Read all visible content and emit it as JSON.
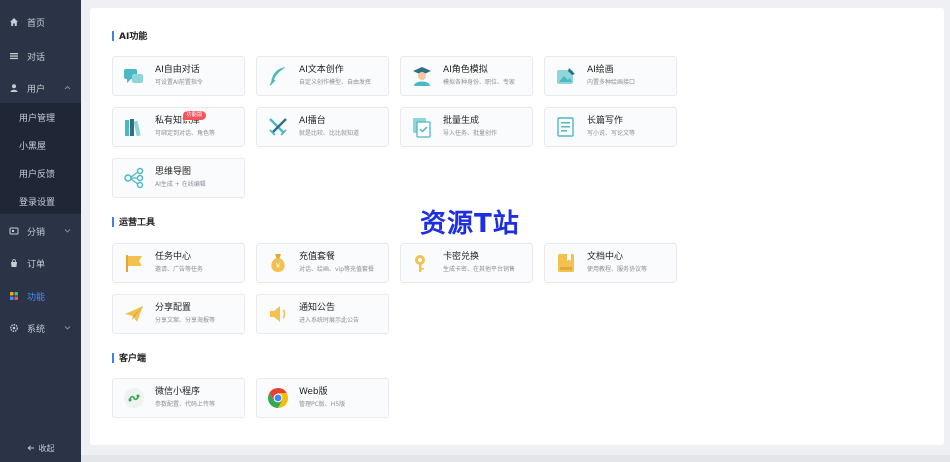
{
  "sidebar": {
    "items": [
      {
        "label": "首页",
        "icon": "home-icon"
      },
      {
        "label": "对话",
        "icon": "list-icon"
      },
      {
        "label": "用户",
        "icon": "user-icon"
      },
      {
        "label": "分销",
        "icon": "distribution-icon"
      },
      {
        "label": "订单",
        "icon": "bag-icon"
      },
      {
        "label": "功能",
        "icon": "grid-icon"
      },
      {
        "label": "系统",
        "icon": "gear-icon"
      }
    ],
    "user_submenu": [
      "用户管理",
      "小黑屋",
      "用户反馈",
      "登录设置"
    ],
    "collapse_label": "收起",
    "active_color": "#4a8df8"
  },
  "sections": [
    {
      "title": "AI功能",
      "cards": [
        {
          "name": "AI自由对话",
          "desc": "可设置AI前置指令",
          "icon": "chat-icon"
        },
        {
          "name": "AI文本创作",
          "desc": "自定义创作模型、自由发挥",
          "icon": "feather-icon"
        },
        {
          "name": "AI角色模拟",
          "desc": "模拟各种身份、职位、专家",
          "icon": "role-icon"
        },
        {
          "name": "AI绘画",
          "desc": "内置多种绘画接口",
          "icon": "paint-icon"
        },
        {
          "name": "私有知识库",
          "desc": "可绑定到对话、角色等",
          "icon": "books-icon",
          "badge": "功能版"
        },
        {
          "name": "AI擂台",
          "desc": "就是比较、比比就知道",
          "icon": "swords-icon"
        },
        {
          "name": "批量生成",
          "desc": "导入任务、批量创作",
          "icon": "batch-icon"
        },
        {
          "name": "长篇写作",
          "desc": "写小说、写论文等",
          "icon": "longtext-icon"
        },
        {
          "name": "思维导图",
          "desc": "AI生成 + 在线编辑",
          "icon": "mindmap-icon"
        }
      ]
    },
    {
      "title": "运营工具",
      "cards": [
        {
          "name": "任务中心",
          "desc": "邀请、广告等任务",
          "icon": "flag-icon"
        },
        {
          "name": "充值套餐",
          "desc": "对话、绘画、vip等充值套餐",
          "icon": "moneybag-icon"
        },
        {
          "name": "卡密兑换",
          "desc": "生成卡密、在其他平台销售",
          "icon": "key-icon"
        },
        {
          "name": "文档中心",
          "desc": "使用教程、服务协议等",
          "icon": "document-icon"
        },
        {
          "name": "分享配置",
          "desc": "分享文案、分享海报等",
          "icon": "paperplane-icon"
        },
        {
          "name": "通知公告",
          "desc": "进入系统时展示此公告",
          "icon": "speaker-icon"
        }
      ]
    },
    {
      "title": "客户端",
      "cards": [
        {
          "name": "微信小程序",
          "desc": "参数配置、代码上传等",
          "icon": "miniprogram-icon"
        },
        {
          "name": "Web版",
          "desc": "管理PC版、H5版",
          "icon": "chrome-icon"
        }
      ]
    }
  ],
  "watermark": "资源T站",
  "colors": {
    "accent": "#3d7ef5",
    "teal": "#4bb8c4",
    "gold": "#f2c14e",
    "sidebar_bg": "#2b3447"
  }
}
